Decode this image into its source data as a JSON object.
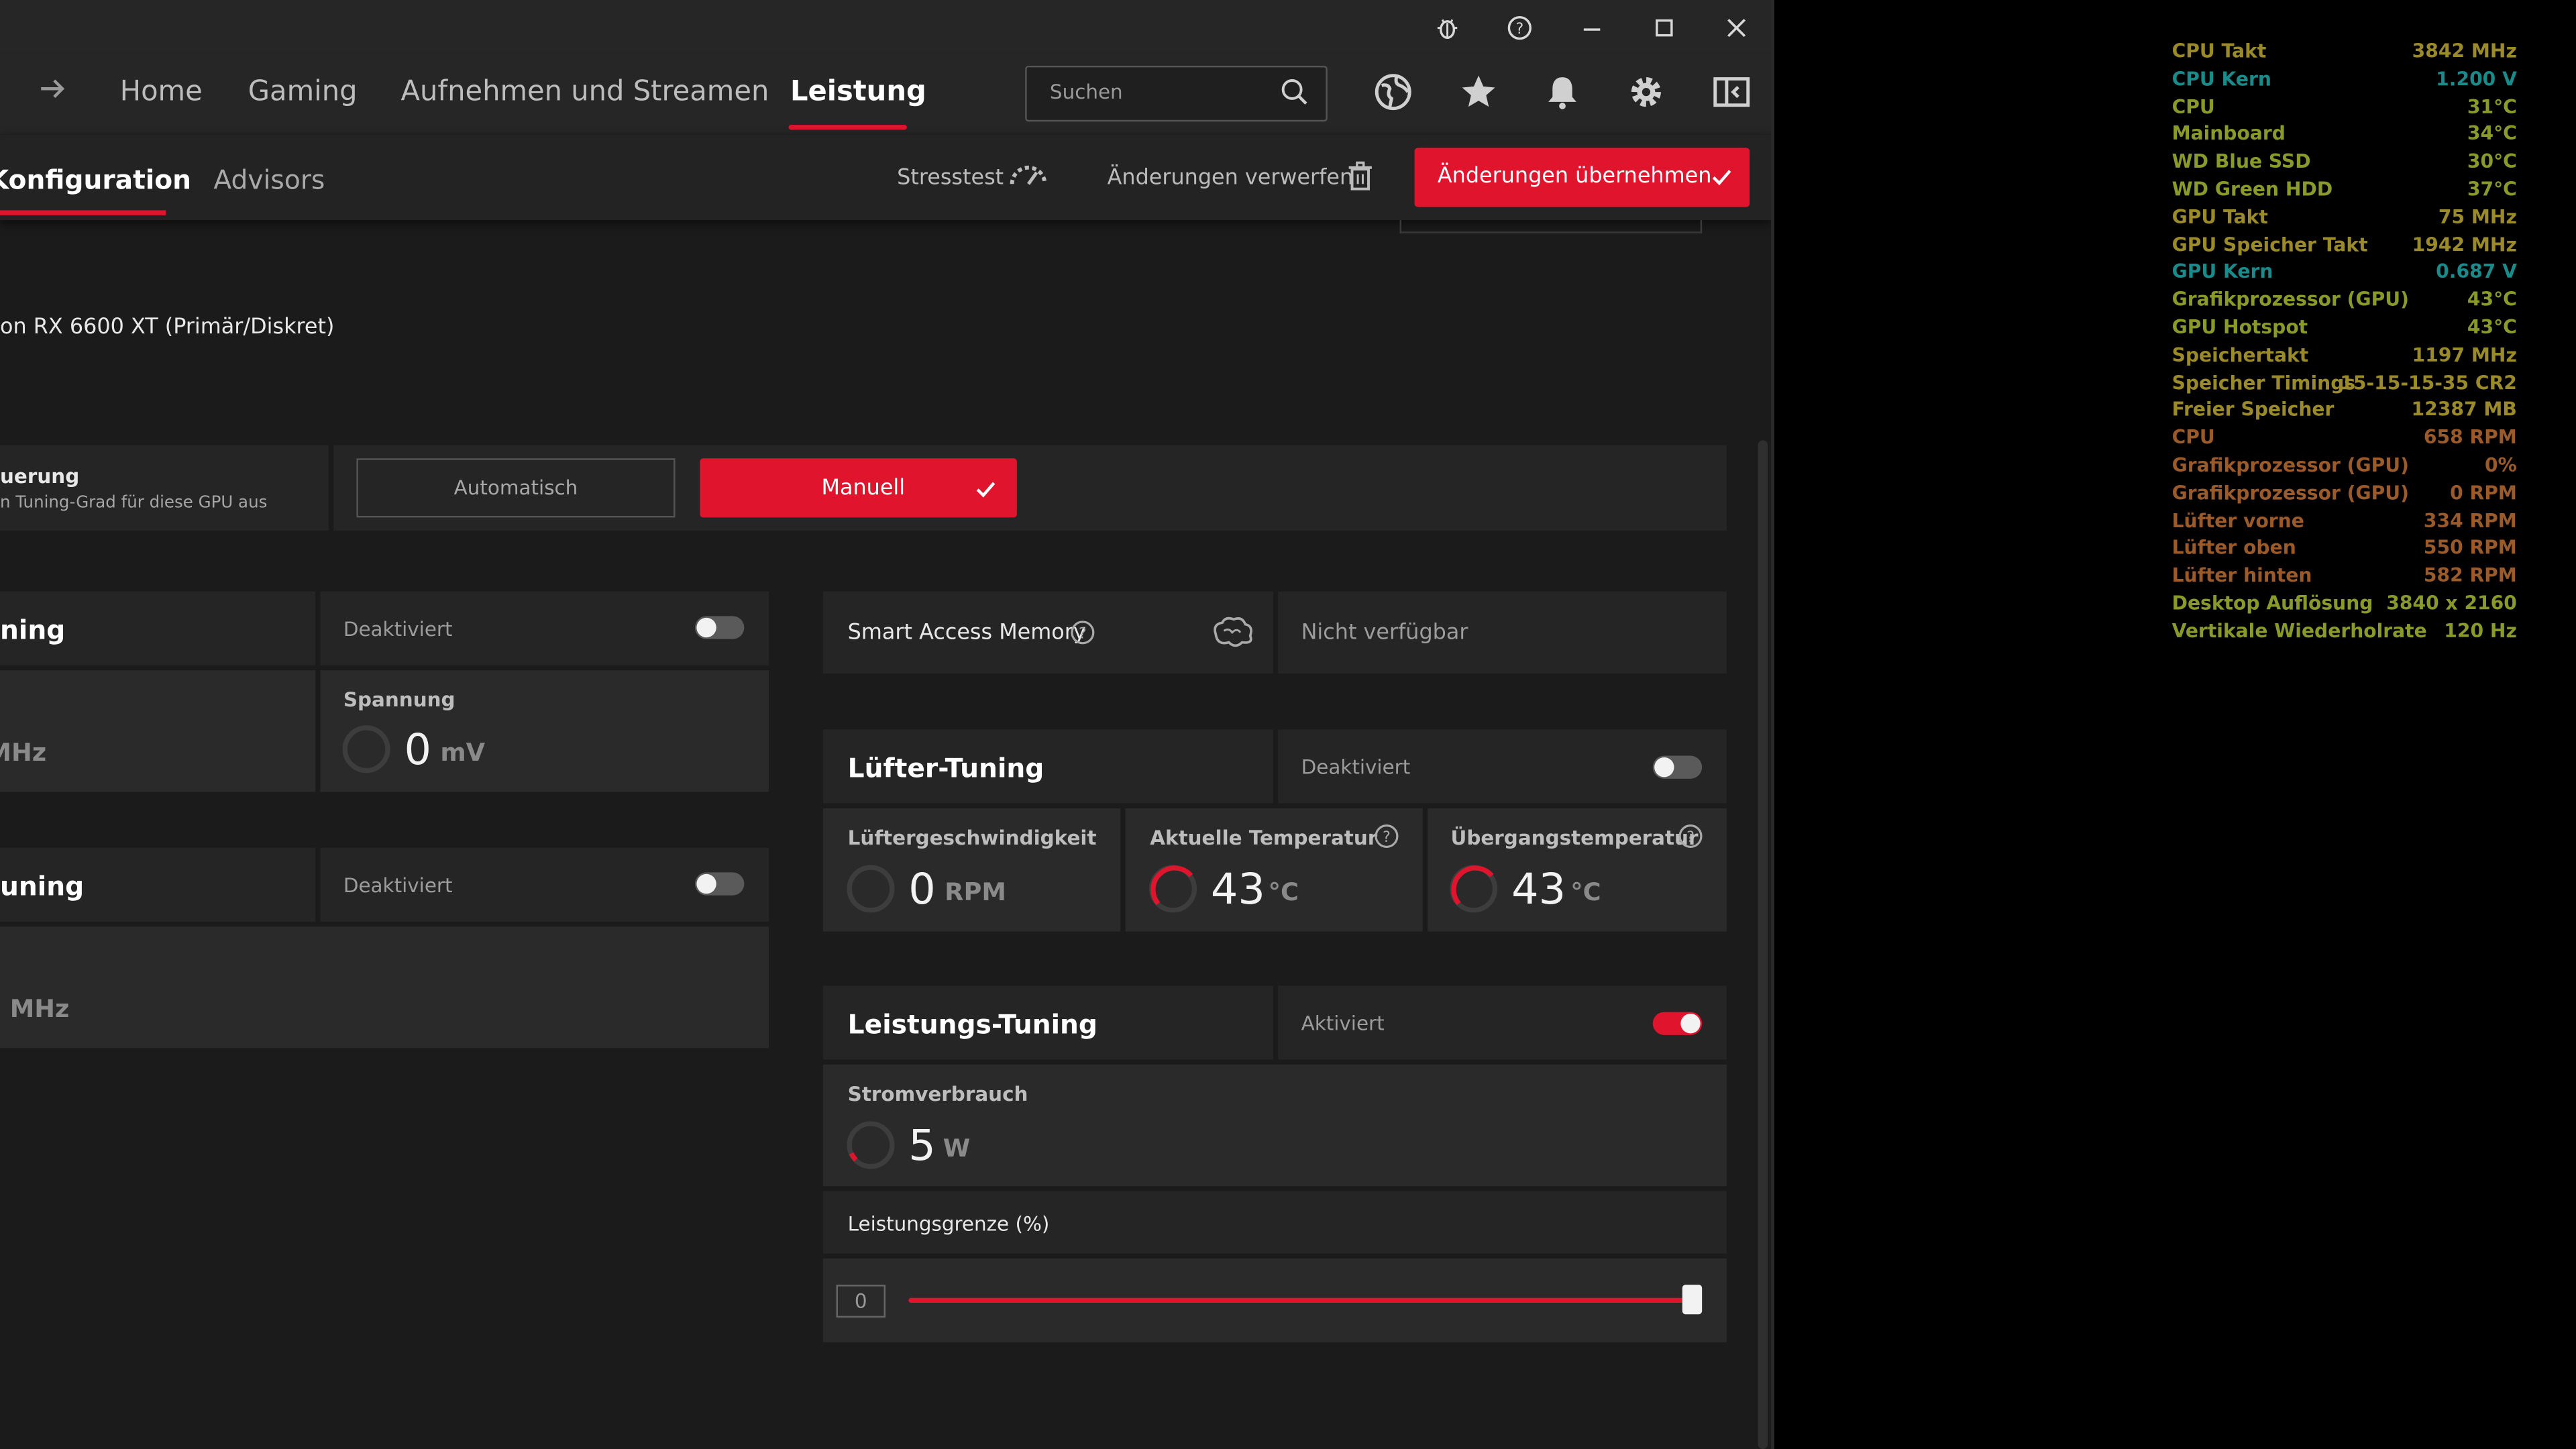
{
  "nav": {
    "items": [
      "Home",
      "Gaming",
      "Aufnehmen und Streamen",
      "Leistung"
    ],
    "search_placeholder": "Suchen"
  },
  "subnav": {
    "items": [
      "Konfiguration",
      "Advisors"
    ],
    "stress": "Stresstest",
    "discard": "Änderungen verwerfen",
    "apply": "Änderungen übernehmen"
  },
  "gpu": {
    "name": "on RX 6600 XT (Primär/Diskret)",
    "control_title": "uerung",
    "control_desc": "n Tuning-Grad für diese GPU aus",
    "auto": "Automatisch",
    "manual": "Manuell"
  },
  "left_section1": {
    "title": "ning",
    "state": "Deaktiviert",
    "spannung_label": "Spannung",
    "spannung_value": "0",
    "spannung_unit": "mV",
    "mhz_unit": "MHz"
  },
  "left_section2": {
    "title": "uning",
    "state": "Deaktiviert",
    "mhz_unit": "MHz"
  },
  "sam": {
    "label": "Smart Access Memory",
    "status": "Nicht verfügbar"
  },
  "fan": {
    "title": "Lüfter-Tuning",
    "state": "Deaktiviert",
    "speed_label": "Lüftergeschwindigkeit",
    "speed_value": "0",
    "speed_unit": "RPM",
    "temp_label": "Aktuelle Temperatur",
    "temp_value": "43",
    "temp_unit": "°C",
    "junction_label": "Übergangstemperatur",
    "junction_value": "43",
    "junction_unit": "°C"
  },
  "power": {
    "title": "Leistungs-Tuning",
    "state": "Aktiviert",
    "consumption_label": "Stromverbrauch",
    "consumption_value": "5",
    "consumption_unit": "W",
    "limit_label": "Leistungsgrenze (%)",
    "limit_value": "0"
  },
  "overlay": [
    {
      "label": "CPU Takt",
      "value": "3842 MHz",
      "color": "#9a8a2a"
    },
    {
      "label": "CPU Kern",
      "value": "1.200 V",
      "color": "#1a8a8a"
    },
    {
      "label": "CPU",
      "value": "31°C",
      "color": "#8a9a2a"
    },
    {
      "label": "Mainboard",
      "value": "34°C",
      "color": "#8a9a2a"
    },
    {
      "label": "WD Blue SSD",
      "value": "30°C",
      "color": "#8a9a2a"
    },
    {
      "label": "WD Green HDD",
      "value": "37°C",
      "color": "#8a9a2a"
    },
    {
      "label": "GPU Takt",
      "value": "75 MHz",
      "color": "#9a8a2a"
    },
    {
      "label": "GPU Speicher Takt",
      "value": "1942 MHz",
      "color": "#9a8a2a"
    },
    {
      "label": "GPU Kern",
      "value": "0.687 V",
      "color": "#1a8a8a"
    },
    {
      "label": "Grafikprozessor (GPU)",
      "value": "43°C",
      "color": "#8a9a2a"
    },
    {
      "label": "GPU Hotspot",
      "value": "43°C",
      "color": "#8a9a2a"
    },
    {
      "label": "Speichertakt",
      "value": "1197 MHz",
      "color": "#9a8a2a"
    },
    {
      "label": "Speicher Timings",
      "value": "15-15-15-35 CR2",
      "color": "#9a8a2a"
    },
    {
      "label": "Freier Speicher",
      "value": "12387 MB",
      "color": "#9a8a2a"
    },
    {
      "label": "CPU",
      "value": "658 RPM",
      "color": "#9a5a2a"
    },
    {
      "label": "Grafikprozessor (GPU)",
      "value": "0%",
      "color": "#9a5a2a"
    },
    {
      "label": "Grafikprozessor (GPU)",
      "value": "0 RPM",
      "color": "#9a5a2a"
    },
    {
      "label": "Lüfter vorne",
      "value": "334 RPM",
      "color": "#9a5a2a"
    },
    {
      "label": "Lüfter oben",
      "value": "550 RPM",
      "color": "#9a5a2a"
    },
    {
      "label": "Lüfter hinten",
      "value": "582 RPM",
      "color": "#9a5a2a"
    },
    {
      "label": "Desktop Auflösung",
      "value": "3840 x 2160",
      "color": "#8a9a2a"
    },
    {
      "label": "Vertikale Wiederholrate",
      "value": "120 Hz",
      "color": "#8a9a2a"
    }
  ]
}
